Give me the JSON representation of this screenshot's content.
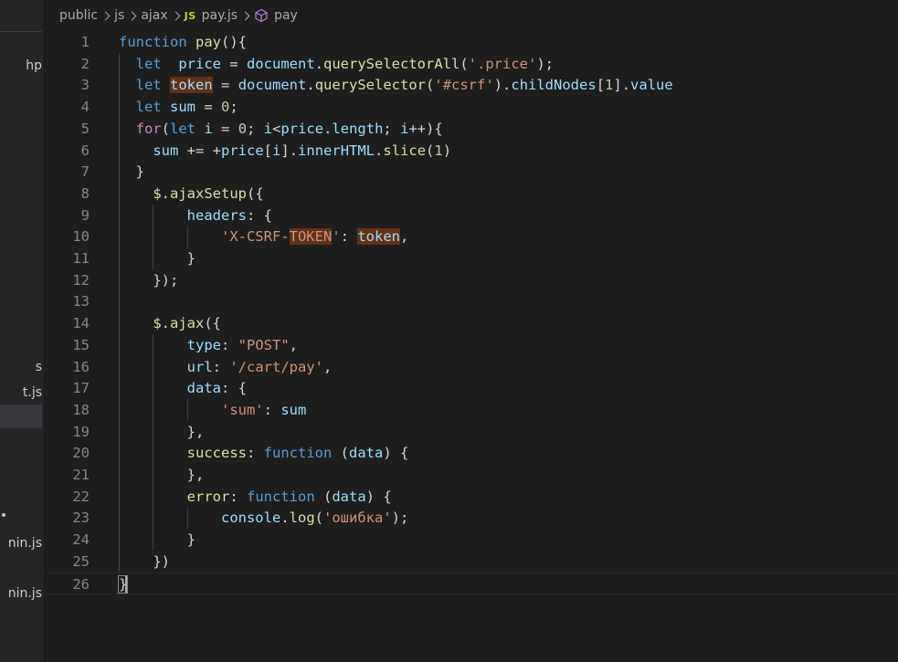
{
  "breadcrumb": {
    "items": [
      "public",
      "js",
      "ajax"
    ],
    "file_badge": "JS",
    "file": "pay.js",
    "symbol": "pay"
  },
  "sidebar": {
    "visible_fragments": [
      "hp",
      "s",
      "t.js",
      "nin.js",
      "nin.js"
    ]
  },
  "editor": {
    "language": "javascript",
    "lines": [
      {
        "n": "1",
        "tokens": [
          [
            "kw",
            "function"
          ],
          [
            "pl",
            " "
          ],
          [
            "fn",
            "pay"
          ],
          [
            "pl",
            "()"
          ],
          [
            "pl",
            "{"
          ]
        ]
      },
      {
        "n": "2",
        "tokens": [
          [
            "pl",
            "  "
          ],
          [
            "kw",
            "let"
          ],
          [
            "pl",
            "  "
          ],
          [
            "var",
            "price"
          ],
          [
            "pl",
            " = "
          ],
          [
            "var",
            "document"
          ],
          [
            "pl",
            "."
          ],
          [
            "fn",
            "querySelectorAll"
          ],
          [
            "pl",
            "("
          ],
          [
            "str",
            "'.price'"
          ],
          [
            "pl",
            ");"
          ]
        ]
      },
      {
        "n": "3",
        "tokens": [
          [
            "pl",
            "  "
          ],
          [
            "kw",
            "let"
          ],
          [
            "pl",
            " "
          ],
          [
            "var",
            "token",
            "hl"
          ],
          [
            "pl",
            " = "
          ],
          [
            "var",
            "document"
          ],
          [
            "pl",
            "."
          ],
          [
            "fn",
            "querySelector"
          ],
          [
            "pl",
            "("
          ],
          [
            "str",
            "'#csrf'"
          ],
          [
            "pl",
            ")."
          ],
          [
            "var",
            "childNodes"
          ],
          [
            "pl",
            "["
          ],
          [
            "num",
            "1"
          ],
          [
            "pl",
            "]."
          ],
          [
            "var",
            "value"
          ]
        ]
      },
      {
        "n": "4",
        "tokens": [
          [
            "pl",
            "  "
          ],
          [
            "kw",
            "let"
          ],
          [
            "pl",
            " "
          ],
          [
            "var",
            "sum"
          ],
          [
            "pl",
            " = "
          ],
          [
            "num",
            "0"
          ],
          [
            "pl",
            ";"
          ]
        ]
      },
      {
        "n": "5",
        "tokens": [
          [
            "pl",
            "  "
          ],
          [
            "ctl",
            "for"
          ],
          [
            "pl",
            "("
          ],
          [
            "kw",
            "let"
          ],
          [
            "pl",
            " "
          ],
          [
            "var",
            "i"
          ],
          [
            "pl",
            " = "
          ],
          [
            "num",
            "0"
          ],
          [
            "pl",
            "; "
          ],
          [
            "var",
            "i"
          ],
          [
            "pl",
            "<"
          ],
          [
            "var",
            "price"
          ],
          [
            "pl",
            "."
          ],
          [
            "var",
            "length"
          ],
          [
            "pl",
            "; "
          ],
          [
            "var",
            "i"
          ],
          [
            "pl",
            "++){"
          ]
        ]
      },
      {
        "n": "6",
        "tokens": [
          [
            "pl",
            "    "
          ],
          [
            "var",
            "sum"
          ],
          [
            "pl",
            " += +"
          ],
          [
            "var",
            "price"
          ],
          [
            "pl",
            "["
          ],
          [
            "var",
            "i"
          ],
          [
            "pl",
            "]."
          ],
          [
            "var",
            "innerHTML"
          ],
          [
            "pl",
            "."
          ],
          [
            "fn",
            "slice"
          ],
          [
            "pl",
            "("
          ],
          [
            "num",
            "1"
          ],
          [
            "pl",
            ")"
          ]
        ]
      },
      {
        "n": "7",
        "tokens": [
          [
            "pl",
            "  }"
          ]
        ]
      },
      {
        "n": "8",
        "tokens": [
          [
            "pl",
            "    "
          ],
          [
            "fn",
            "$"
          ],
          [
            "pl",
            "."
          ],
          [
            "fn",
            "ajaxSetup"
          ],
          [
            "pl",
            "({"
          ]
        ]
      },
      {
        "n": "9",
        "tokens": [
          [
            "pl",
            "        "
          ],
          [
            "var",
            "headers"
          ],
          [
            "pl",
            ": {"
          ]
        ]
      },
      {
        "n": "10",
        "tokens": [
          [
            "pl",
            "            "
          ],
          [
            "str",
            "'X-CSRF-"
          ],
          [
            "str",
            "TOKEN",
            "hl"
          ],
          [
            "str",
            "'"
          ],
          [
            "pl",
            ": "
          ],
          [
            "var",
            "token",
            "hl"
          ],
          [
            "pl",
            ","
          ]
        ]
      },
      {
        "n": "11",
        "tokens": [
          [
            "pl",
            "        }"
          ]
        ]
      },
      {
        "n": "12",
        "tokens": [
          [
            "pl",
            "    });"
          ]
        ]
      },
      {
        "n": "13",
        "tokens": []
      },
      {
        "n": "14",
        "tokens": [
          [
            "pl",
            "    "
          ],
          [
            "fn",
            "$"
          ],
          [
            "pl",
            "."
          ],
          [
            "fn",
            "ajax"
          ],
          [
            "pl",
            "({"
          ]
        ]
      },
      {
        "n": "15",
        "tokens": [
          [
            "pl",
            "        "
          ],
          [
            "var",
            "type"
          ],
          [
            "pl",
            ": "
          ],
          [
            "str",
            "\"POST\""
          ],
          [
            "pl",
            ","
          ]
        ]
      },
      {
        "n": "16",
        "tokens": [
          [
            "pl",
            "        "
          ],
          [
            "var",
            "url"
          ],
          [
            "pl",
            ": "
          ],
          [
            "str",
            "'/cart/pay'"
          ],
          [
            "pl",
            ","
          ]
        ]
      },
      {
        "n": "17",
        "tokens": [
          [
            "pl",
            "        "
          ],
          [
            "var",
            "data"
          ],
          [
            "pl",
            ": {"
          ]
        ]
      },
      {
        "n": "18",
        "tokens": [
          [
            "pl",
            "            "
          ],
          [
            "str",
            "'sum'"
          ],
          [
            "pl",
            ": "
          ],
          [
            "var",
            "sum"
          ]
        ]
      },
      {
        "n": "19",
        "tokens": [
          [
            "pl",
            "        },"
          ]
        ]
      },
      {
        "n": "20",
        "tokens": [
          [
            "pl",
            "        "
          ],
          [
            "fn",
            "success"
          ],
          [
            "pl",
            ": "
          ],
          [
            "kw",
            "function"
          ],
          [
            "pl",
            " ("
          ],
          [
            "var",
            "data"
          ],
          [
            "pl",
            ") {"
          ]
        ]
      },
      {
        "n": "21",
        "tokens": [
          [
            "pl",
            "        },"
          ]
        ]
      },
      {
        "n": "22",
        "tokens": [
          [
            "pl",
            "        "
          ],
          [
            "fn",
            "error"
          ],
          [
            "pl",
            ": "
          ],
          [
            "kw",
            "function"
          ],
          [
            "pl",
            " ("
          ],
          [
            "var",
            "data"
          ],
          [
            "pl",
            ") {"
          ]
        ]
      },
      {
        "n": "23",
        "tokens": [
          [
            "pl",
            "            "
          ],
          [
            "var",
            "console"
          ],
          [
            "pl",
            "."
          ],
          [
            "fn",
            "log"
          ],
          [
            "pl",
            "("
          ],
          [
            "str",
            "'ошибка'"
          ],
          [
            "pl",
            ");"
          ]
        ]
      },
      {
        "n": "24",
        "tokens": [
          [
            "pl",
            "        }"
          ]
        ]
      },
      {
        "n": "25",
        "tokens": [
          [
            "pl",
            "    })"
          ]
        ]
      },
      {
        "n": "26",
        "tokens": [
          [
            "pl",
            "}",
            "cursor"
          ]
        ]
      }
    ]
  },
  "colors": {
    "background": "#1e1e1e",
    "sidebar": "#252526",
    "keyword": "#569cd6",
    "control": "#c586c0",
    "variable": "#9cdcfe",
    "function": "#dcdcaa",
    "string": "#ce9178",
    "number": "#b5cea8",
    "highlight": "#613214",
    "line_number": "#858585"
  }
}
